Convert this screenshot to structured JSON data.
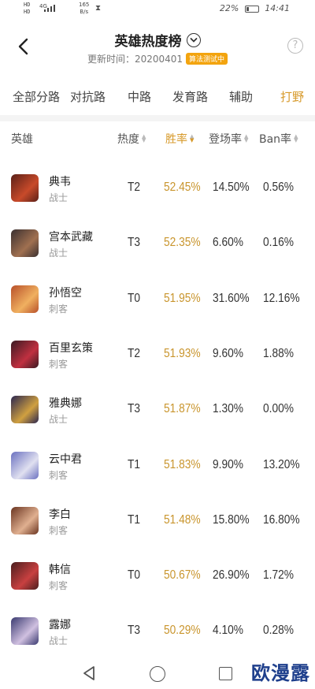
{
  "status_bar": {
    "hd1": "HD",
    "hd2": "HD",
    "network": "4G",
    "speed_value": "165",
    "speed_unit": "B/s",
    "battery_percent": "22%",
    "time": "14:41"
  },
  "header": {
    "title": "英雄热度榜",
    "update_label": "更新时间：",
    "update_date": "20200401",
    "badge": "算法测试中",
    "help_symbol": "?"
  },
  "tabs": [
    {
      "label": "全部分路",
      "active": false
    },
    {
      "label": "对抗路",
      "active": false
    },
    {
      "label": "中路",
      "active": false
    },
    {
      "label": "发育路",
      "active": false
    },
    {
      "label": "辅助",
      "active": false
    },
    {
      "label": "打野",
      "active": true
    }
  ],
  "table": {
    "headers": {
      "hero": "英雄",
      "heat": "热度",
      "win_rate": "胜率",
      "pick_rate": "登场率",
      "ban_rate": "Ban率"
    },
    "rows": [
      {
        "name": "典韦",
        "role": "战士",
        "heat": "T2",
        "win": "52.45%",
        "pick": "14.50%",
        "ban": "0.56%",
        "c1": "#5a2018",
        "c2": "#c84a2a"
      },
      {
        "name": "宫本武藏",
        "role": "战士",
        "heat": "T3",
        "win": "52.35%",
        "pick": "6.60%",
        "ban": "0.16%",
        "c1": "#3a3030",
        "c2": "#a07050"
      },
      {
        "name": "孙悟空",
        "role": "刺客",
        "heat": "T0",
        "win": "51.95%",
        "pick": "31.60%",
        "ban": "12.16%",
        "c1": "#b8502a",
        "c2": "#f0b060"
      },
      {
        "name": "百里玄策",
        "role": "刺客",
        "heat": "T2",
        "win": "51.93%",
        "pick": "9.60%",
        "ban": "1.88%",
        "c1": "#3a1a22",
        "c2": "#c03040"
      },
      {
        "name": "雅典娜",
        "role": "战士",
        "heat": "T3",
        "win": "51.87%",
        "pick": "1.30%",
        "ban": "0.00%",
        "c1": "#2a2650",
        "c2": "#d0a040"
      },
      {
        "name": "云中君",
        "role": "刺客",
        "heat": "T1",
        "win": "51.83%",
        "pick": "9.90%",
        "ban": "13.20%",
        "c1": "#6a70c0",
        "c2": "#e0e0f0"
      },
      {
        "name": "李白",
        "role": "刺客",
        "heat": "T1",
        "win": "51.48%",
        "pick": "15.80%",
        "ban": "16.80%",
        "c1": "#6a3420",
        "c2": "#e0b090"
      },
      {
        "name": "韩信",
        "role": "刺客",
        "heat": "T0",
        "win": "50.67%",
        "pick": "26.90%",
        "ban": "1.72%",
        "c1": "#4a1e1e",
        "c2": "#c84040"
      },
      {
        "name": "露娜",
        "role": "战士",
        "heat": "T3",
        "win": "50.29%",
        "pick": "4.10%",
        "ban": "0.28%",
        "c1": "#3a3a70",
        "c2": "#d0c0e0"
      }
    ]
  },
  "watermark": "欧漫露",
  "colors": {
    "accent": "#d79a2b",
    "win_rate": "#c9952d",
    "badge": "#f3a40f"
  }
}
